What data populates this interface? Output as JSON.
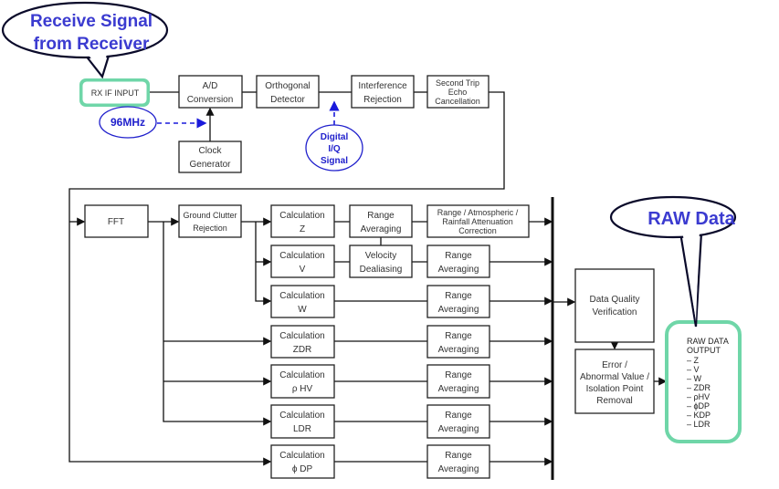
{
  "callouts": {
    "receive": [
      "Receive Signal",
      "from Receiver"
    ],
    "raw": "RAW Data"
  },
  "top_row": {
    "rx_input": "RX IF INPUT",
    "ad": [
      "A/D",
      "Conversion"
    ],
    "orthogonal": [
      "Orthogonal",
      "Detector"
    ],
    "interference": [
      "Interference",
      "Rejection"
    ],
    "second_trip": [
      "Second Trip",
      "Echo",
      "Cancellation"
    ],
    "clock": [
      "Clock",
      "Generator"
    ],
    "freq": "96MHz",
    "iq": [
      "Digital",
      "I/Q",
      "Signal"
    ]
  },
  "processing": {
    "fft": "FFT",
    "ground_clutter": [
      "Ground Clutter",
      "Rejection"
    ],
    "calc": [
      [
        "Calculation",
        "Z"
      ],
      [
        "Calculation",
        "V"
      ],
      [
        "Calculation",
        "W"
      ],
      [
        "Calculation",
        "ZDR"
      ],
      [
        "Calculation",
        "ρ HV"
      ],
      [
        "Calculation",
        "ϕ DP"
      ]
    ],
    "calc_ldr": [
      "Calculation",
      "LDR"
    ],
    "range_avg": [
      "Range",
      "Averaging"
    ],
    "velocity": [
      "Velocity",
      "Dealiasing"
    ],
    "correction": [
      "Range / Atmospheric /",
      "Rainfall Attenuation",
      "Correction"
    ],
    "dq": [
      "Data Quality",
      "Verification"
    ],
    "error": [
      "Error /",
      "Abnormal Value /",
      "Isolation Point",
      "Removal"
    ]
  },
  "output": {
    "title": [
      "RAW DATA",
      "OUTPUT"
    ],
    "items": [
      "– Z",
      "– V",
      "– W",
      "– ZDR",
      "– ρHV",
      "– ϕDP",
      "– KDP",
      "– LDR"
    ]
  },
  "colors": {
    "callout_text": "#3b3bd0",
    "annotation": "#2020cc",
    "output_border": "#6fd6a8"
  }
}
